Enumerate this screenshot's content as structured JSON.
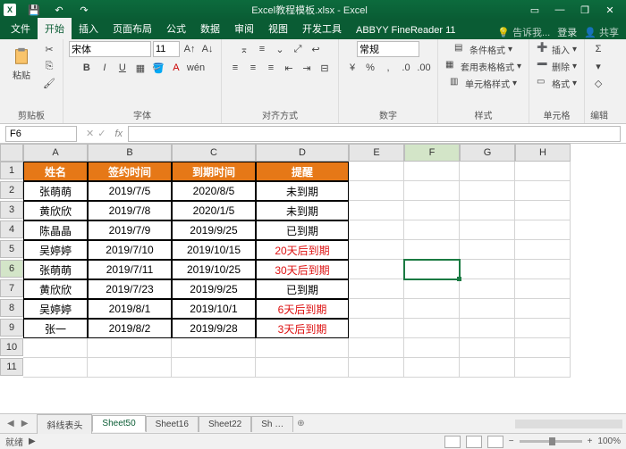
{
  "app": {
    "title": "Excel教程模板.xlsx - Excel",
    "icon": "X"
  },
  "tabs": {
    "items": [
      "文件",
      "开始",
      "插入",
      "页面布局",
      "公式",
      "数据",
      "审阅",
      "视图",
      "开发工具",
      "ABBYY FineReader 11"
    ],
    "active": 1,
    "tellme": "告诉我...",
    "login": "登录",
    "share": "共享"
  },
  "ribbon": {
    "clipboard": {
      "label": "剪贴板",
      "paste": "粘贴"
    },
    "font": {
      "label": "字体",
      "name": "宋体",
      "size": "11",
      "bold": "B",
      "italic": "I",
      "underline": "U"
    },
    "align": {
      "label": "对齐方式"
    },
    "number": {
      "label": "数字",
      "category": "常规",
      "percent": "%",
      "comma": ",",
      "inc": ".0",
      "dec": ".00"
    },
    "styles": {
      "label": "样式",
      "cond": "条件格式",
      "tbl": "套用表格格式",
      "cell": "单元格样式"
    },
    "cells": {
      "label": "单元格",
      "ins": "插入",
      "del": "删除",
      "fmt": "格式"
    },
    "editing": {
      "label": "编辑"
    }
  },
  "namebox": "F6",
  "chart_data": {
    "type": "table",
    "title": "",
    "columns": [
      "姓名",
      "签约时间",
      "到期时间",
      "提醒"
    ],
    "rows": [
      {
        "name": "张萌萌",
        "sign": "2019/7/5",
        "due": "2020/8/5",
        "note": "未到期",
        "red": false
      },
      {
        "name": "黄欣欣",
        "sign": "2019/7/8",
        "due": "2020/1/5",
        "note": "未到期",
        "red": false
      },
      {
        "name": "陈晶晶",
        "sign": "2019/7/9",
        "due": "2019/9/25",
        "note": "已到期",
        "red": false
      },
      {
        "name": "吴婷婷",
        "sign": "2019/7/10",
        "due": "2019/10/15",
        "note": "20天后到期",
        "red": true
      },
      {
        "name": "张萌萌",
        "sign": "2019/7/11",
        "due": "2019/10/25",
        "note": "30天后到期",
        "red": true
      },
      {
        "name": "黄欣欣",
        "sign": "2019/7/23",
        "due": "2019/9/25",
        "note": "已到期",
        "red": false
      },
      {
        "name": "吴婷婷",
        "sign": "2019/8/1",
        "due": "2019/10/1",
        "note": "6天后到期",
        "red": true
      },
      {
        "name": "张一",
        "sign": "2019/8/2",
        "due": "2019/9/28",
        "note": "3天后到期",
        "red": true
      }
    ]
  },
  "grid": {
    "cols": [
      "A",
      "B",
      "C",
      "D",
      "E",
      "F",
      "G",
      "H"
    ],
    "active_col": 5,
    "active_row": 6,
    "rowcount": 11
  },
  "sheets": {
    "items": [
      "斜线表头",
      "Sheet50",
      "Sheet16",
      "Sheet22",
      "Sh …"
    ],
    "active": 1,
    "nav": [
      "◀",
      "▶"
    ]
  },
  "status": {
    "ready": "就绪",
    "zoom": "100%",
    "minus": "−",
    "plus": "+"
  }
}
